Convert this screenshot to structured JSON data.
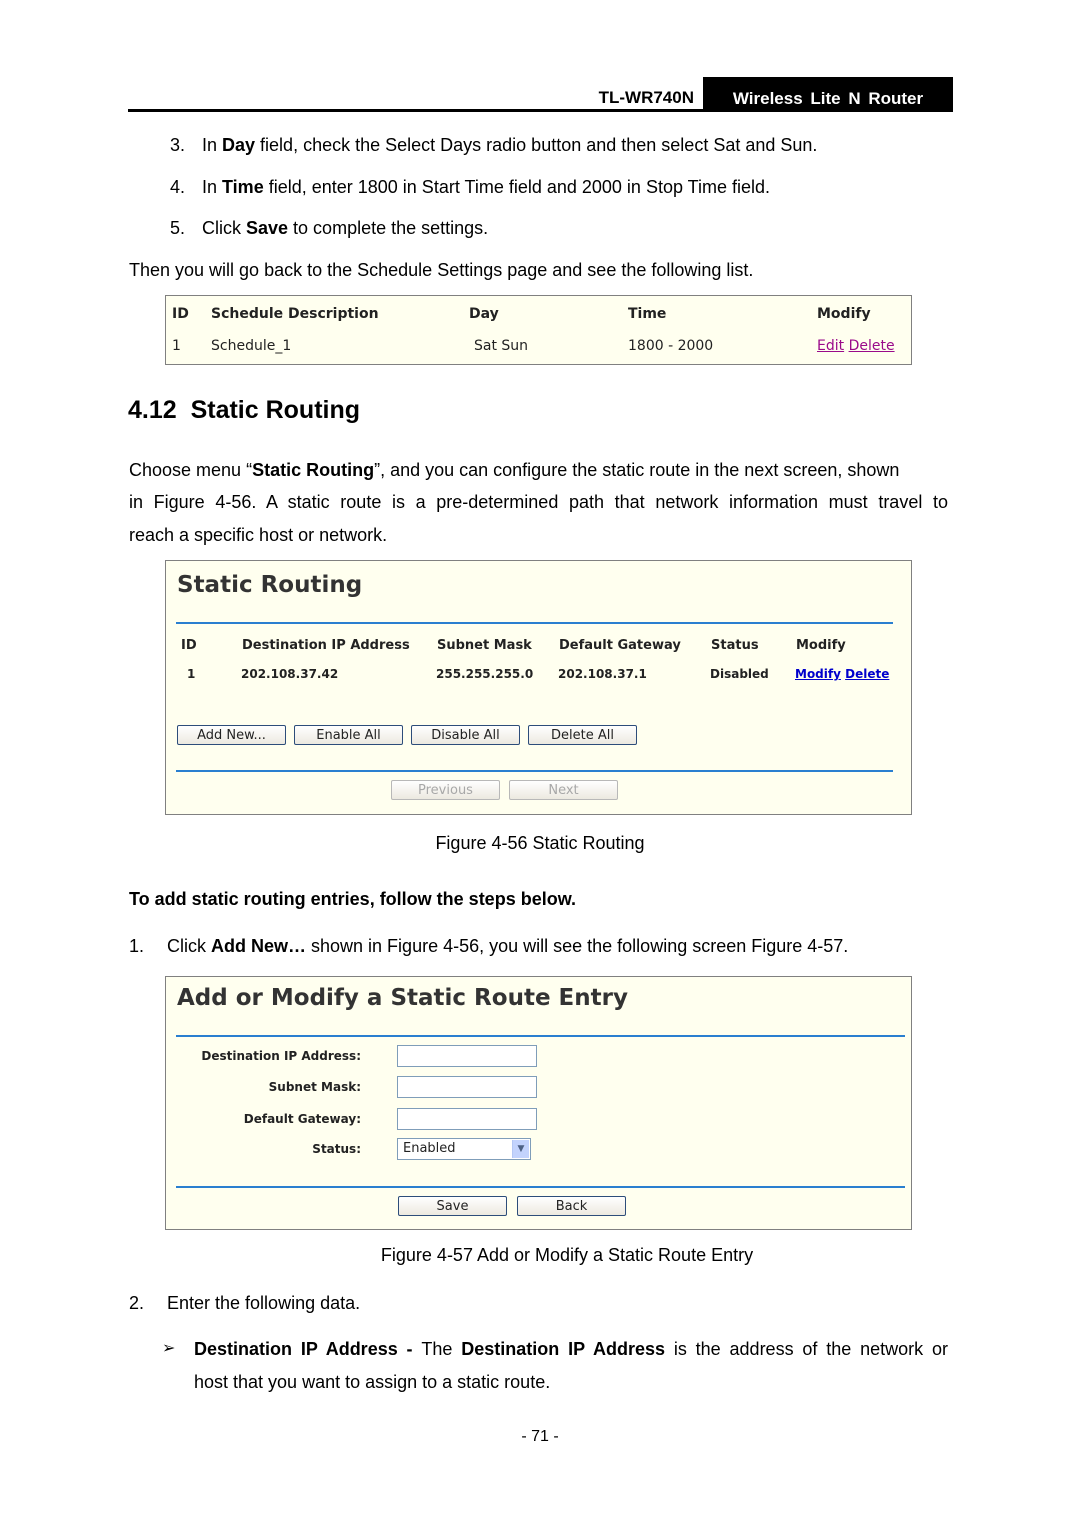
{
  "header": {
    "model": "TL-WR740N",
    "product": "Wireless  Lite  N  Router"
  },
  "steps_top": [
    {
      "num": "3.",
      "pre": "In ",
      "bold": "Day",
      "post": " field, check the Select Days radio button and then select Sat and Sun."
    },
    {
      "num": "4.",
      "pre": "In ",
      "bold": "Time",
      "post": " field, enter 1800 in Start Time field and 2000 in Stop Time field."
    },
    {
      "num": "5.",
      "pre": "Click ",
      "bold": "Save",
      "post": " to complete the settings."
    }
  ],
  "then_text": "Then you will go back to the Schedule Settings page and see the following list.",
  "schedule_table": {
    "headers": [
      "ID",
      "Schedule Description",
      "Day",
      "Time",
      "Modify"
    ],
    "rows": [
      {
        "id": "1",
        "description": "Schedule_1",
        "day": "Sat Sun",
        "time": "1800 - 2000",
        "edit": "Edit",
        "delete": "Delete"
      }
    ]
  },
  "section": {
    "number": "4.12",
    "title": "Static Routing"
  },
  "intro": {
    "line1_pre": "Choose menu “",
    "line1_bold": "Static Routing",
    "line1_post": "”, and you can configure the static route in the next screen, shown",
    "line2": "in Figure 4-56. A static route is a pre-determined path that network information must travel to",
    "line3": "reach a specific host or network."
  },
  "static_routing_panel": {
    "title": "Static Routing",
    "headers": [
      "ID",
      "Destination IP Address",
      "Subnet Mask",
      "Default Gateway",
      "Status",
      "Modify"
    ],
    "rows": [
      {
        "id": "1",
        "dest_ip": "202.108.37.42",
        "subnet": "255.255.255.0",
        "gateway": "202.108.37.1",
        "status": "Disabled",
        "modify": "Modify",
        "delete": "Delete"
      }
    ],
    "buttons": {
      "add_new": "Add New...",
      "enable_all": "Enable All",
      "disable_all": "Disable All",
      "delete_all": "Delete All",
      "previous": "Previous",
      "next": "Next"
    }
  },
  "figure_56_caption": "Figure 4-56    Static Routing",
  "steps_heading": "To add static routing entries, follow the steps below.",
  "step1": {
    "num": "1.",
    "pre": "Click ",
    "bold": "Add New…",
    "post": " shown in Figure 4-56, you will see the following screen Figure 4-57."
  },
  "route_entry_panel": {
    "title": "Add or Modify a Static Route Entry",
    "labels": {
      "dest_ip": "Destination IP Address:",
      "subnet": "Subnet Mask:",
      "gateway": "Default Gateway:",
      "status": "Status:"
    },
    "values": {
      "dest_ip": "",
      "subnet": "",
      "gateway": "",
      "status": "Enabled"
    },
    "buttons": {
      "save": "Save",
      "back": "Back"
    }
  },
  "figure_57_caption": "Figure 4-57    Add or Modify a Static Route Entry",
  "step2": {
    "num": "2.",
    "text": "Enter the following data."
  },
  "bullet": {
    "marker": "➢",
    "bold1": "Destination IP Address - ",
    "plain1": "The ",
    "bold2": "Destination IP Address",
    "plain2": " is the address of the network or",
    "line2": "host that you want to assign to a static route."
  },
  "page_number": "- 71 -"
}
